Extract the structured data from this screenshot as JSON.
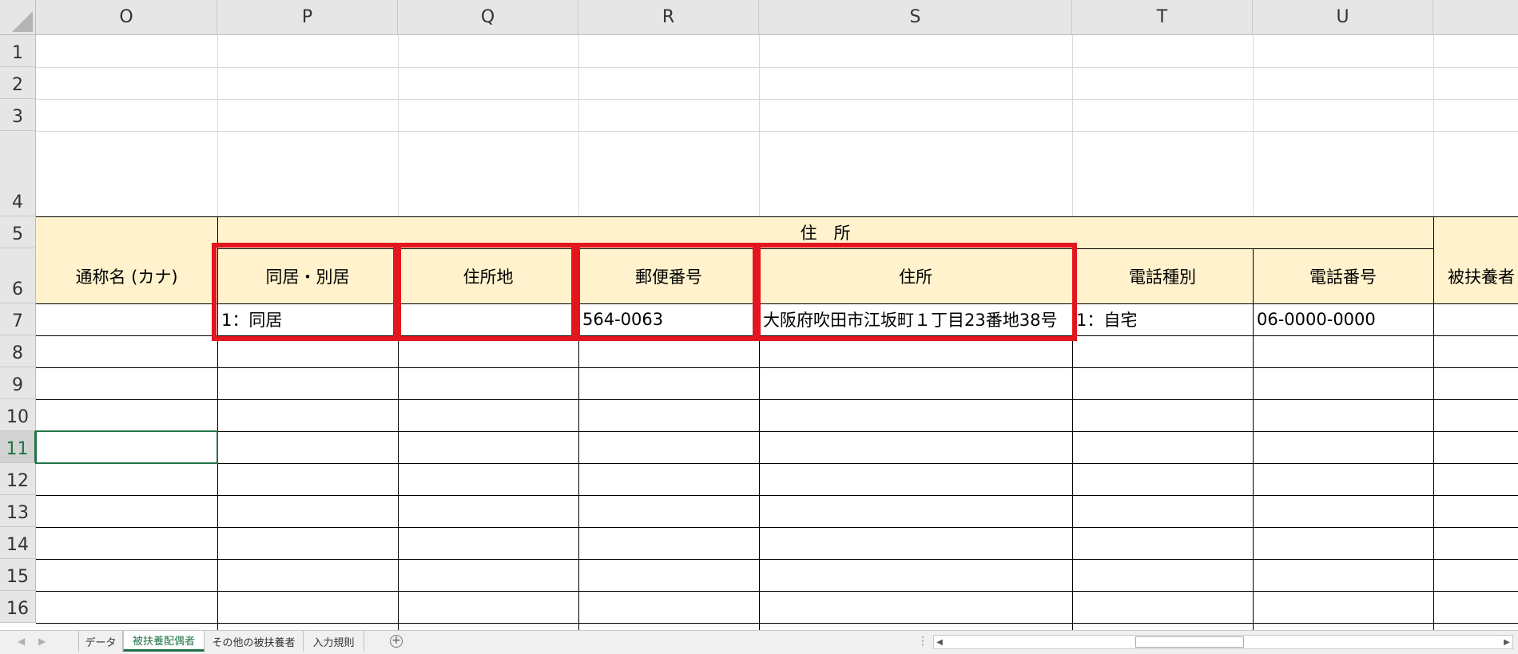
{
  "columns": [
    "O",
    "P",
    "Q",
    "R",
    "S",
    "T",
    "U"
  ],
  "rows": [
    "1",
    "2",
    "3",
    "4",
    "5",
    "6",
    "7",
    "8",
    "9",
    "10",
    "11",
    "12",
    "13",
    "14",
    "15",
    "16"
  ],
  "active_row": "11",
  "group_header": "住　所",
  "headers": {
    "O": "通称名 (カナ)",
    "P": "同居・別居",
    "Q": "住所地",
    "R": "郵便番号",
    "S": "住所",
    "T": "電話種別",
    "U": "電話番号",
    "V": "被扶養者"
  },
  "row7": {
    "O": "",
    "P": "1：同居",
    "Q": "",
    "R": "564-0063",
    "S": "大阪府吹田市江坂町１丁目23番地38号",
    "T": "1：自宅",
    "U": "06-0000-0000",
    "V": ""
  },
  "sheet_tabs": [
    "データ",
    "被扶養配偶者",
    "その他の被扶養者",
    "入力規則"
  ],
  "active_tab": "被扶養配偶者",
  "colors": {
    "header_fill": "#fff2cc",
    "highlight": "#e3151f",
    "accent": "#217346"
  },
  "icons": [
    "nav-prev-icon",
    "nav-next-icon",
    "add-sheet-icon",
    "scroll-left-icon",
    "scroll-right-icon"
  ]
}
